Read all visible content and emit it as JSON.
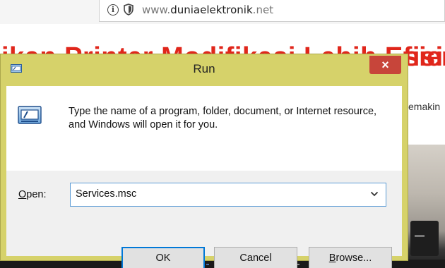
{
  "browser": {
    "url_prefix": "www.",
    "url_domain": "duniaelektronik",
    "url_suffix": ".net",
    "icons": [
      "info-icon",
      "shield-icon"
    ]
  },
  "page": {
    "heading_fragment": "ikan Printer Modifikasi Lebih Efisien",
    "heading_tail": "sien",
    "text_fragment": "emakin"
  },
  "dialog": {
    "title": "Run",
    "close_label": "×",
    "description": "Type the name of a program, folder, document, or Internet resource, and Windows will open it for you.",
    "open_label_accel": "O",
    "open_label_rest": "pen:",
    "open_value": "Services.msc",
    "buttons": {
      "ok": "OK",
      "cancel": "Cancel",
      "browse_accel": "B",
      "browse_rest": "rowse..."
    },
    "icons": [
      "run-icon",
      "chevron-down-icon",
      "close-icon"
    ],
    "colors": {
      "frame": "#d6d26a",
      "close_button": "#c7453a",
      "focus_border": "#0078d7",
      "heading_red": "#e0261b"
    }
  }
}
